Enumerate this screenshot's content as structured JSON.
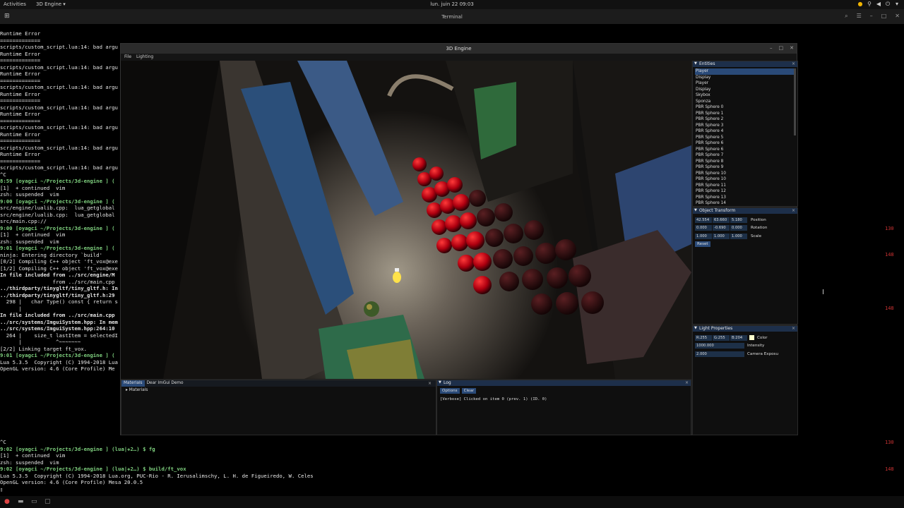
{
  "topbar": {
    "activities": "Activities",
    "app_menu": "3D Engine ▾",
    "clock": "lun. juin 22  09:03"
  },
  "terminal": {
    "title": "Terminal",
    "lines": [
      "Runtime Error",
      "=============",
      "scripts/custom_script.lua:14: bad argu",
      "",
      "Runtime Error",
      "=============",
      "scripts/custom_script.lua:14: bad argu",
      "",
      "Runtime Error",
      "=============",
      "scripts/custom_script.lua:14: bad argu",
      "",
      "Runtime Error",
      "=============",
      "scripts/custom_script.lua:14: bad argu",
      "",
      "Runtime Error",
      "=============",
      "scripts/custom_script.lua:14: bad argu",
      "",
      "Runtime Error",
      "=============",
      "scripts/custom_script.lua:14: bad argu",
      "",
      "Runtime Error",
      "=============",
      "scripts/custom_script.lua:14: bad argu",
      "",
      "^C",
      "8:59 [oyagci ~/Projects/3d-engine ] (",
      "[1]  + continued  vim",
      "",
      "zsh: suspended  vim",
      "9:00 [oyagci ~/Projects/3d-engine ] (",
      "src/engine/lualib.cpp:  lua_getglobal",
      "src/engine/lualib.cpp:  lua_getglobal",
      "src/main.cpp://",
      "9:00 [oyagci ~/Projects/3d-engine ] (",
      "[1]  + continued  vim",
      "",
      "zsh: suspended  vim",
      "9:01 [oyagci ~/Projects/3d-engine ] (",
      "ninja: Entering directory `build'",
      "[0/2] Compiling C++ object 'ft_vox@exe",
      "[1/2] Compiling C++ object 'ft_vox@exe",
      "In file included from ../src/engine/M",
      "                 from ../src/main.cpp",
      "../thirdparty/tinygltf/tiny_gltf.h: In",
      "../thirdparty/tinygltf/tiny_gltf.h:29",
      "  298 |   char Type() const { return s",
      "      |",
      "",
      "In file included from ../src/main.cpp",
      "../src/systems/ImguiSystem.hpp: In mem",
      "../src/systems/ImguiSystem.hpp:264:10",
      "  264 |    size_t lastItem = selectedI",
      "      |           ^~~~~~~~",
      "",
      "[2/2] Linking target ft_vox.",
      "9:01 [oyagci ~/Projects/3d-engine ] (",
      "Lua 5.3.5  Copyright (C) 1994-2018 Lua",
      "OpenGL version: 4.6 (Core Profile) Me"
    ],
    "bottom_lines": [
      "^C",
      "9:02 [oyagci ~/Projects/3d-engine ] (lua|✚2…) $ fg",
      "[1]  + continued  vim",
      "",
      "zsh: suspended  vim",
      "9:02 [oyagci ~/Projects/3d-engine ] (lua|✚2…) $ build/ft_vox",
      "Lua 5.3.5  Copyright (C) 1994-2018 Lua.org, PUC-Rio - R. Ierusalimschy, L. H. de Figueiredo, W. Celes",
      "OpenGL version: 4.6 (Core Profile) Mesa 20.0.5",
      "▯"
    ],
    "right_numbers": [
      "130",
      "148",
      "148",
      "130",
      "148"
    ]
  },
  "engine": {
    "title": "3D Engine",
    "menu": [
      "File",
      "Lighting"
    ],
    "entities": {
      "title": "Entities",
      "items": [
        "Player",
        "Display",
        "Player",
        "Display",
        "Skybox",
        "Sponza",
        "PBR Sphere 0",
        "PBR Sphere 1",
        "PBR Sphere 2",
        "PBR Sphere 3",
        "PBR Sphere 4",
        "PBR Sphere 5",
        "PBR Sphere 6",
        "PBR Sphere 6",
        "PBR Sphere 7",
        "PBR Sphere 8",
        "PBR Sphere 9",
        "PBR Sphere 10",
        "PBR Sphere 10",
        "PBR Sphere 11",
        "PBR Sphere 12",
        "PBR Sphere 13",
        "PBR Sphere 14"
      ]
    },
    "transform": {
      "title": "Object Transform",
      "position": [
        "42.554",
        "63.660",
        "5.180"
      ],
      "position_label": "Position",
      "rotation": [
        "0.000",
        "-0.690",
        "0.000"
      ],
      "rotation_label": "Rotation",
      "scale": [
        "1.000",
        "1.000",
        "1.000"
      ],
      "scale_label": "Scale",
      "reset": "Reset"
    },
    "light": {
      "title": "Light Properties",
      "color": [
        "R:255",
        "G:255",
        "B:204"
      ],
      "color_label": "Color",
      "swatch_color": "#ffffcc",
      "intensity": "1000.000",
      "intensity_label": "Intensity",
      "exposure": "2.000",
      "exposure_label": "Camera Exposu"
    },
    "materials": {
      "tabs": [
        "Materials",
        "Dear ImGui Demo"
      ],
      "tree_item": "Materials"
    },
    "log": {
      "title": "Log",
      "options": "Options",
      "clear": "Clear",
      "message": "[Verbose] Clicked on item 0 (prev. 1) (ID. 0)"
    }
  }
}
